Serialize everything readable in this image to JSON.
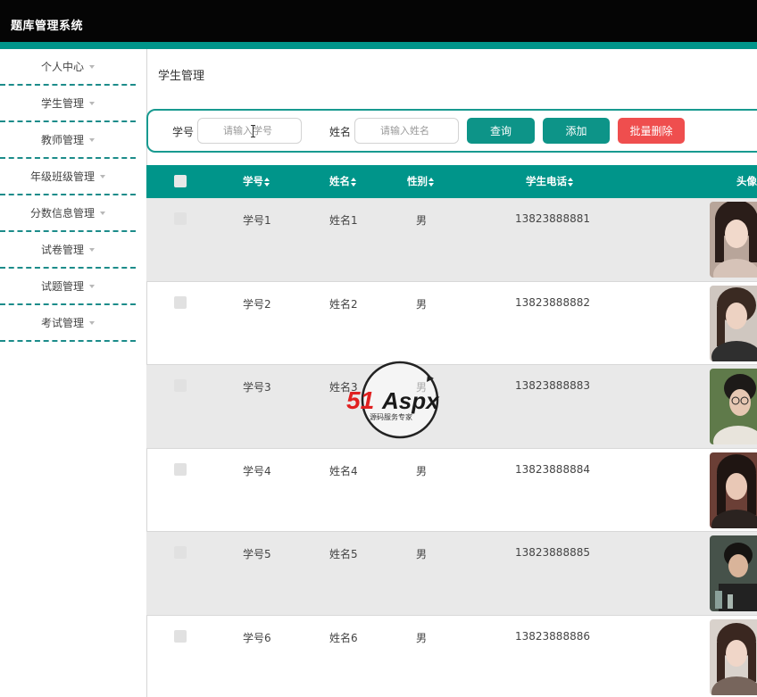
{
  "app": {
    "title": "题库管理系统"
  },
  "sidebar": {
    "items": [
      {
        "label": "个人中心"
      },
      {
        "label": "学生管理"
      },
      {
        "label": "教师管理"
      },
      {
        "label": "年级班级管理"
      },
      {
        "label": "分数信息管理"
      },
      {
        "label": "试卷管理"
      },
      {
        "label": "试题管理"
      },
      {
        "label": "考试管理"
      }
    ]
  },
  "page": {
    "title": "学生管理"
  },
  "search": {
    "student_id_label": "学号",
    "student_id_placeholder": "请输入学号",
    "name_label": "姓名",
    "name_placeholder": "请输入姓名",
    "query_button": "查询",
    "add_button": "添加",
    "batch_delete_button": "批量删除"
  },
  "table": {
    "headers": {
      "student_id": "学号",
      "name": "姓名",
      "gender": "性别",
      "phone": "学生电话",
      "avatar": "头像"
    },
    "rows": [
      {
        "student_id": "学号1",
        "name": "姓名1",
        "gender": "男",
        "phone": "13823888881"
      },
      {
        "student_id": "学号2",
        "name": "姓名2",
        "gender": "男",
        "phone": "13823888882"
      },
      {
        "student_id": "学号3",
        "name": "姓名3",
        "gender": "男",
        "phone": "13823888883"
      },
      {
        "student_id": "学号4",
        "name": "姓名4",
        "gender": "男",
        "phone": "13823888884"
      },
      {
        "student_id": "学号5",
        "name": "姓名5",
        "gender": "男",
        "phone": "13823888885"
      },
      {
        "student_id": "学号6",
        "name": "姓名6",
        "gender": "男",
        "phone": "13823888886"
      }
    ]
  },
  "watermark": {
    "brand": "51Aspx",
    "tagline": "源码服务专家"
  },
  "colors": {
    "accent": "#00958a",
    "danger": "#ef4e4e",
    "topbar": "#050505"
  }
}
